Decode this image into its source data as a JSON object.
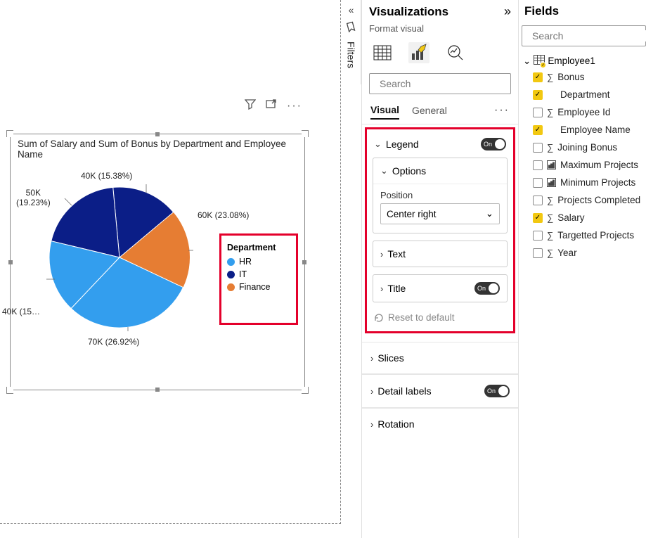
{
  "filters_tab": {
    "label": "Filters"
  },
  "visual": {
    "title": "Sum of Salary and Sum of Bonus by Department and Employee Name",
    "legend_title": "Department",
    "legend_items": [
      {
        "label": "HR",
        "color": "#339eee"
      },
      {
        "label": "IT",
        "color": "#0b1e87"
      },
      {
        "label": "Finance",
        "color": "#e67d33"
      }
    ],
    "pie_labels": {
      "a": "60K (23.08%)",
      "b": "40K (15.38%)",
      "c_1": "50K",
      "c_2": "(19.23%)",
      "d": "40K (15…",
      "e": "70K (26.92%)"
    }
  },
  "viz_panel": {
    "title": "Visualizations",
    "subtitle": "Format visual",
    "search_placeholder": "Search",
    "tabs": {
      "visual": "Visual",
      "general": "General"
    },
    "legend_section": {
      "label": "Legend",
      "toggle_text": "On",
      "options": {
        "label": "Options",
        "position_label": "Position",
        "position_value": "Center right"
      },
      "text_label": "Text",
      "title_label": "Title",
      "title_toggle": "On",
      "reset": "Reset to default"
    },
    "slices": "Slices",
    "detail_labels": {
      "label": "Detail labels",
      "toggle": "On"
    },
    "rotation": "Rotation"
  },
  "fields_panel": {
    "title": "Fields",
    "search_placeholder": "Search",
    "table": "Employee1",
    "fields": [
      {
        "name": "Bonus",
        "checked": true,
        "icon": "sigma"
      },
      {
        "name": "Department",
        "checked": true,
        "icon": ""
      },
      {
        "name": "Employee Id",
        "checked": false,
        "icon": "sigma"
      },
      {
        "name": "Employee Name",
        "checked": true,
        "icon": ""
      },
      {
        "name": "Joining Bonus",
        "checked": false,
        "icon": "sigma"
      },
      {
        "name": "Maximum Projects",
        "checked": false,
        "icon": "kpi"
      },
      {
        "name": "Minimum Projects",
        "checked": false,
        "icon": "kpi"
      },
      {
        "name": "Projects Completed",
        "checked": false,
        "icon": "sigma"
      },
      {
        "name": "Salary",
        "checked": true,
        "icon": "sigma"
      },
      {
        "name": "Targetted Projects",
        "checked": false,
        "icon": "sigma"
      },
      {
        "name": "Year",
        "checked": false,
        "icon": "sigma"
      }
    ]
  },
  "chart_data": {
    "type": "pie",
    "title": "Sum of Salary and Sum of Bonus by Department and Employee Name",
    "slices": [
      {
        "label": "60K",
        "value": 60,
        "percent": 23.08,
        "color": "#e67d33"
      },
      {
        "label": "40K",
        "value": 40,
        "percent": 15.38,
        "color": "#0b1e87"
      },
      {
        "label": "50K",
        "value": 50,
        "percent": 19.23,
        "color": "#0b1e87"
      },
      {
        "label": "40K",
        "value": 40,
        "percent": 15.38,
        "color": "#339eee"
      },
      {
        "label": "70K",
        "value": 70,
        "percent": 26.92,
        "color": "#339eee"
      }
    ],
    "legend_title": "Department",
    "legend": [
      {
        "name": "HR",
        "color": "#339eee"
      },
      {
        "name": "IT",
        "color": "#0b1e87"
      },
      {
        "name": "Finance",
        "color": "#e67d33"
      }
    ]
  }
}
